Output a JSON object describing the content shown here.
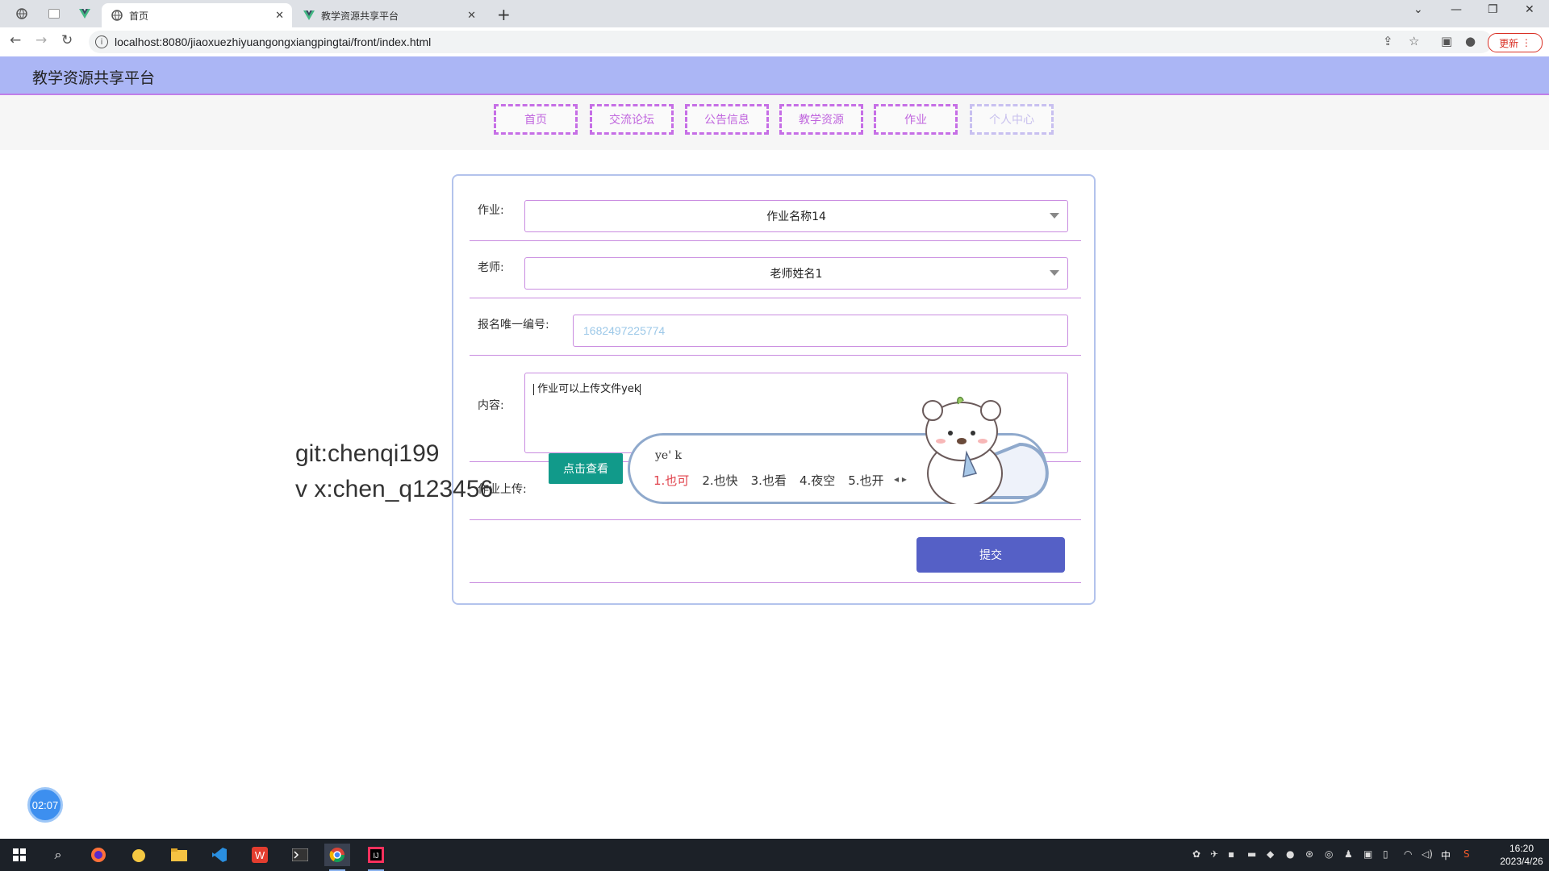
{
  "browser": {
    "tabs": [
      {
        "title": "首页",
        "active": true
      },
      {
        "title": "教学资源共享平台",
        "active": false
      }
    ],
    "url": "localhost:8080/jiaoxuezhiyuangongxiangpingtai/front/index.html",
    "update_label": "更新"
  },
  "site": {
    "title": "教学资源共享平台",
    "nav": [
      "首页",
      "交流论坛",
      "公告信息",
      "教学资源",
      "作业",
      "个人中心"
    ]
  },
  "form": {
    "homework_label": "作业:",
    "homework_value": "作业名称14",
    "teacher_label": "老师:",
    "teacher_value": "老师姓名1",
    "regno_label": "报名唯一编号:",
    "regno_placeholder": "1682497225774",
    "content_label": "内容:",
    "content_value": "作业可以上传文件yek",
    "upload_label": "作业上传:",
    "view_button": "点击查看",
    "submit_button": "提交"
  },
  "watermark": {
    "line1": "git:chenqi199",
    "line2": "v x:chen_q123456"
  },
  "ime": {
    "input": "ye' k",
    "candidates": [
      "1.也可",
      "2.也快",
      "3.也看",
      "4.夜空",
      "5.也开"
    ]
  },
  "timer": "02:07",
  "taskbar": {
    "time": "16:20",
    "date": "2023/4/26",
    "lang": "中"
  },
  "colors": {
    "header_bg": "#abb6f5",
    "nav_border": "#c66ee6",
    "view_button": "#119a8a",
    "submit_button": "#5560c6"
  }
}
